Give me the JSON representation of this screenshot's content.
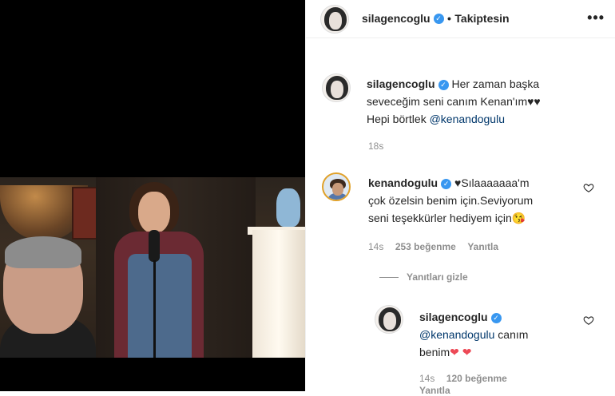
{
  "post": {
    "author": "silagencoglu",
    "follow_sep": "•",
    "follow_status": "Takiptesin",
    "more": "•••"
  },
  "caption": {
    "author": "silagencoglu",
    "line1": "Her zaman başka",
    "line2": "seveceğim seni canım Kenan'ım♥♥",
    "line3_prefix": "Hepi börtlek",
    "line3_mention": "@kenandogulu",
    "time": "18s"
  },
  "comment1": {
    "author": "kenandogulu",
    "line1": "♥Sılaaaaaaa'm",
    "line2": "çok özelsin benim için.Seviyorum",
    "line3": "seni teşekkürler hediyem için😘",
    "time": "14s",
    "likes": "253 beğenme",
    "reply": "Yanıtla"
  },
  "hide_replies": "Yanıtları gizle",
  "reply1": {
    "author": "silagencoglu",
    "mention": "@kenandogulu",
    "text_after": "canım",
    "line2": "benim",
    "hearts": "❤ ❤",
    "time": "14s",
    "likes": "120 beğenme",
    "reply": "Yanıtla"
  },
  "colors": {
    "verified": "#3897f0",
    "meta": "#8e8e8e",
    "mention": "#00376b",
    "heart": "#ed4956"
  }
}
